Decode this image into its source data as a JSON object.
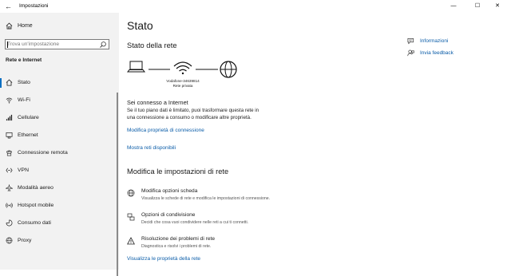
{
  "window": {
    "title": "Impostazioni",
    "back_glyph": "←",
    "minimize_glyph": "—",
    "maximize_glyph": "☐",
    "close_glyph": "✕"
  },
  "sidebar": {
    "home_label": "Home",
    "search_placeholder": "Trova un'impostazione",
    "section_title": "Rete e Internet",
    "items": [
      {
        "label": "Stato",
        "icon": "status-home-icon",
        "active": true
      },
      {
        "label": "Wi-Fi",
        "icon": "wifi-icon"
      },
      {
        "label": "Cellulare",
        "icon": "cellular-icon"
      },
      {
        "label": "Ethernet",
        "icon": "ethernet-icon"
      },
      {
        "label": "Connessione remota",
        "icon": "dialup-icon"
      },
      {
        "label": "VPN",
        "icon": "vpn-icon"
      },
      {
        "label": "Modalità aereo",
        "icon": "airplane-icon"
      },
      {
        "label": "Hotspot mobile",
        "icon": "hotspot-icon"
      },
      {
        "label": "Consumo dati",
        "icon": "data-usage-icon"
      },
      {
        "label": "Proxy",
        "icon": "globe-icon"
      }
    ]
  },
  "main": {
    "title": "Stato",
    "network_status_heading": "Stato della rete",
    "network_name": "Vodafone-34639814",
    "network_type": "Rete privata",
    "connected_title": "Sei connesso a Internet",
    "connected_desc_1": "Se il tuo piano dati è limitato, puoi trasformare questa rete in",
    "connected_desc_2": "una connessione a consumo o modificare altre proprietà.",
    "link_change_properties": "Modifica proprietà di connessione",
    "link_show_networks": "Mostra reti disponibili",
    "change_settings_heading": "Modifica le impostazioni di rete",
    "options": [
      {
        "title": "Modifica opzioni scheda",
        "desc": "Visualizza le schede di rete e modifica le impostazioni di connessione.",
        "icon": "network-adapter-icon"
      },
      {
        "title": "Opzioni di condivisione",
        "desc": "Decidi che cosa vuoi condividere nelle reti a cui ti connetti.",
        "icon": "sharing-icon"
      },
      {
        "title": "Risoluzione dei problemi di rete",
        "desc": "Diagnostica e risolvi i problemi di rete.",
        "icon": "warning-icon"
      }
    ],
    "link_hardware_properties": "Visualizza le proprietà della rete"
  },
  "right": {
    "info_label": "Informazioni",
    "feedback_label": "Invia feedback"
  },
  "colors": {
    "accent": "#0a6fc2",
    "link": "#0a5ca8",
    "sidebar_bg": "#f2f2f2"
  }
}
